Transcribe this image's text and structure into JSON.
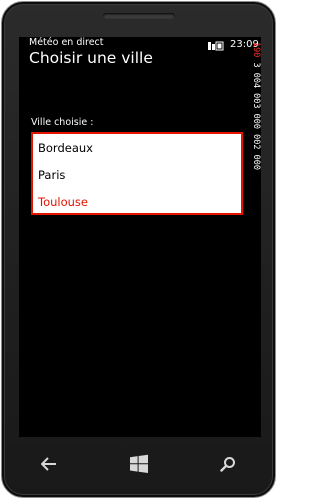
{
  "status_bar": {
    "time": "23:09",
    "icons": [
      "battery-icon"
    ]
  },
  "app": {
    "name": "Météo en direct",
    "page_title": "Choisir une ville"
  },
  "city_picker": {
    "label": "Ville choisie :",
    "items": [
      {
        "label": "Bordeaux",
        "selected": false
      },
      {
        "label": "Paris",
        "selected": false
      },
      {
        "label": "Toulouse",
        "selected": true
      }
    ],
    "accent_color": "#e51400"
  },
  "frame_counter": {
    "highlight": "190",
    "text": " 3 004 003 000 002 000"
  },
  "nav_bar": {
    "buttons": [
      "back-icon",
      "windows-start-icon",
      "search-icon"
    ]
  },
  "colors": {
    "screen_background": "#000000",
    "text": "#ffffff",
    "accent": "#e51400"
  }
}
